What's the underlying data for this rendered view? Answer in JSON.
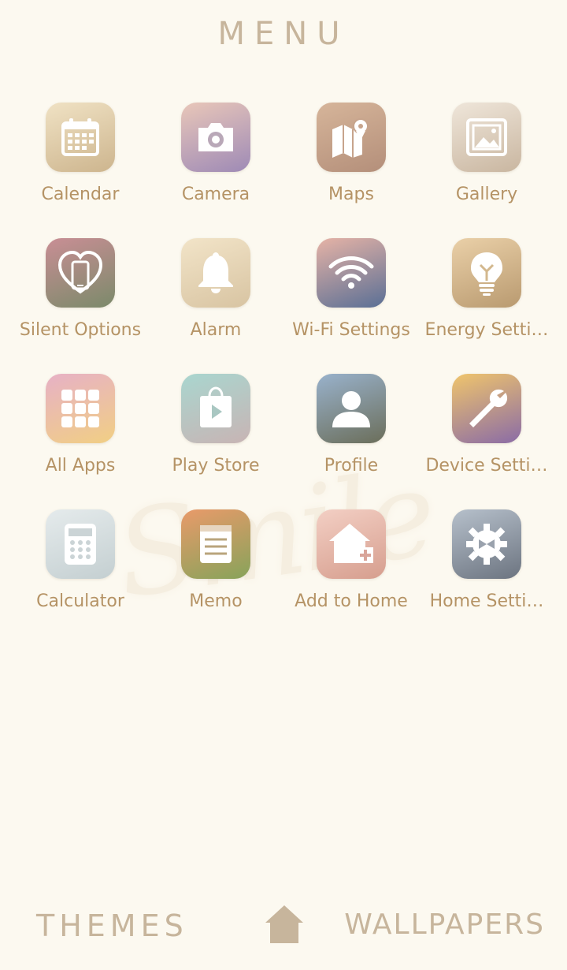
{
  "header": {
    "title": "MENU"
  },
  "apps": [
    {
      "label": "Calendar",
      "icon": "calendar-icon",
      "bg": [
        "#f0e2c4",
        "#cdb58e"
      ]
    },
    {
      "label": "Camera",
      "icon": "camera-icon",
      "bg": [
        "#e9c7b9",
        "#9e8ab6"
      ]
    },
    {
      "label": "Maps",
      "icon": "map-icon",
      "bg": [
        "#d6b59a",
        "#b48f7a"
      ]
    },
    {
      "label": "Gallery",
      "icon": "gallery-icon",
      "bg": [
        "#efe6da",
        "#c9b6a0"
      ]
    },
    {
      "label": "Silent Options",
      "icon": "silent-phone-icon",
      "bg": [
        "#c98e95",
        "#7b8a6a"
      ]
    },
    {
      "label": "Alarm",
      "icon": "bell-icon",
      "bg": [
        "#f2e4c8",
        "#d8c4a2"
      ]
    },
    {
      "label": "Wi-Fi Settings",
      "icon": "wifi-icon",
      "bg": [
        "#e6b3a6",
        "#5a6f95"
      ]
    },
    {
      "label": "Energy Setti…",
      "icon": "lightbulb-icon",
      "bg": [
        "#ead0a8",
        "#b99a70"
      ]
    },
    {
      "label": "All Apps",
      "icon": "grid-apps-icon",
      "bg": [
        "#e7b1c6",
        "#f1cf84"
      ]
    },
    {
      "label": "Play Store",
      "icon": "play-store-icon",
      "bg": [
        "#a9d6cf",
        "#c8b4b4"
      ]
    },
    {
      "label": "Profile",
      "icon": "profile-icon",
      "bg": [
        "#99b2cc",
        "#6b6e5a"
      ]
    },
    {
      "label": "Device Setti…",
      "icon": "wrench-icon",
      "bg": [
        "#f0c56c",
        "#8a6ba6"
      ]
    },
    {
      "label": "Calculator",
      "icon": "calculator-icon",
      "bg": [
        "#e5ebec",
        "#c4cfd1"
      ]
    },
    {
      "label": "Memo",
      "icon": "memo-icon",
      "bg": [
        "#e99a6a",
        "#87a35a"
      ]
    },
    {
      "label": "Add to Home",
      "icon": "add-home-icon",
      "bg": [
        "#f3cfc4",
        "#d69e8e"
      ]
    },
    {
      "label": "Home Setti…",
      "icon": "home-settings-gear-icon",
      "bg": [
        "#b6c0cb",
        "#6c7480"
      ]
    }
  ],
  "bottom": {
    "themes_label": "THEMES",
    "home_icon": "home-icon",
    "wallpapers_label": "WALLPAPERS"
  },
  "colors": {
    "background": "#fcf9f0",
    "label": "#b59365",
    "nav": "#c7b59c"
  }
}
